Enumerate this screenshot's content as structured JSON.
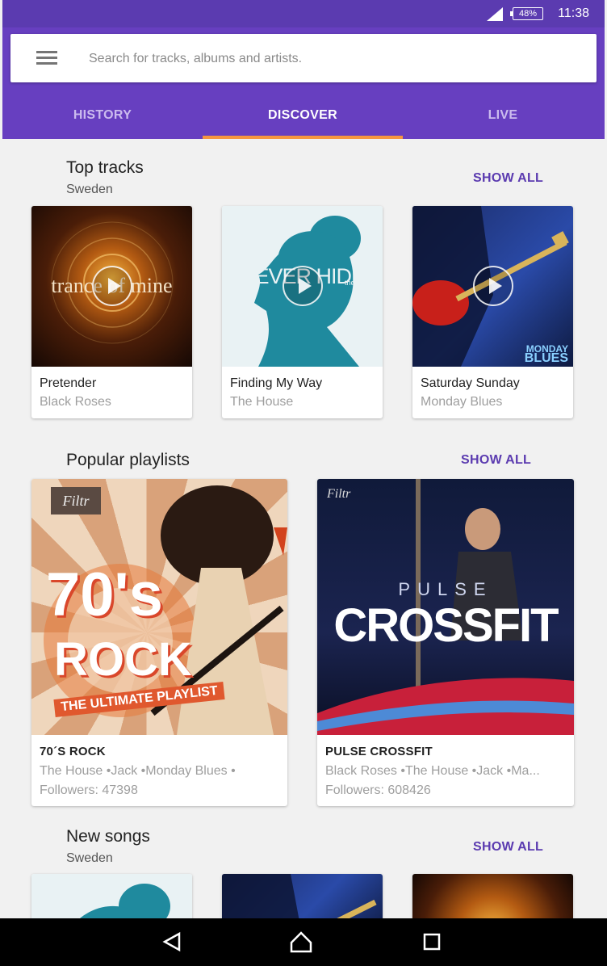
{
  "status_bar": {
    "battery": "48%",
    "time": "11:38"
  },
  "search": {
    "placeholder": "Search for tracks, albums and artists."
  },
  "tabs": [
    {
      "label": "HISTORY"
    },
    {
      "label": "DISCOVER"
    },
    {
      "label": "LIVE"
    }
  ],
  "top_tracks": {
    "title": "Top tracks",
    "subtitle": "Sweden",
    "show_all": "SHOW ALL",
    "items": [
      {
        "title": "Pretender",
        "artist": "Black Roses",
        "art_text": "trance of mine"
      },
      {
        "title": "Finding My Way",
        "artist": "The House",
        "art_text": "NEVER HIDE",
        "art_subtext": "the house"
      },
      {
        "title": "Saturday Sunday",
        "artist": "Monday Blues",
        "art_text": "MONDAY",
        "art_subtext": "BLUES"
      }
    ]
  },
  "popular_playlists": {
    "title": "Popular playlists",
    "show_all": "SHOW ALL",
    "items": [
      {
        "title": "70´S ROCK",
        "artists": "The House  •Jack  •Monday Blues  •",
        "followers": "Followers: 47398",
        "brand": "Filtr",
        "art_text_1": "70's",
        "art_text_2": "ROCK",
        "art_text_3": "THE ULTIMATE PLAYLIST"
      },
      {
        "title": "PULSE CROSSFIT",
        "artists": "Black Roses •The House  •Jack  •Ma...",
        "followers": "Followers: 608426",
        "brand": "Filtr",
        "art_text_1": "PULSE",
        "art_text_2": "CROSSFIT"
      }
    ]
  },
  "new_songs": {
    "title": "New songs",
    "subtitle": "Sweden",
    "show_all": "SHOW ALL"
  },
  "colors": {
    "status_bar": "#5b3bb0",
    "app_bar": "#673fc0",
    "tab_indicator": "#f59640",
    "accent": "#5b3bb0"
  }
}
